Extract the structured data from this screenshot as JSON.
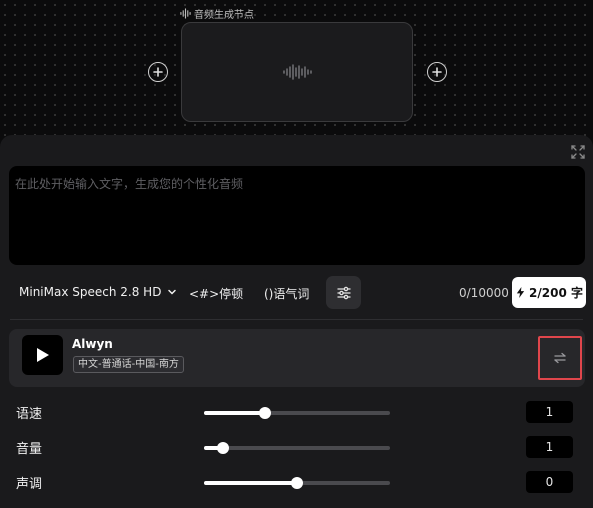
{
  "node": {
    "label": "音频生成节点"
  },
  "editor": {
    "placeholder": "在此处开始输入文字，生成您的个性化音频"
  },
  "toolbar": {
    "model": "MiniMax Speech 2.8 HD",
    "pause_tag": "<#>停顿",
    "tone_tag": "()语气词",
    "char_count": "0/10000",
    "quota": "2/200 字"
  },
  "voice": {
    "name": "Alwyn",
    "tag": "中文-普通话-中国-南方"
  },
  "params": [
    {
      "label": "语速",
      "value": "1",
      "level": 0.33
    },
    {
      "label": "音量",
      "value": "1",
      "level": 0.1
    },
    {
      "label": "声调",
      "value": "0",
      "level": 0.5
    }
  ],
  "colors": {
    "highlight": "#e0464c",
    "panel": "#1a1a1c",
    "accent": "#ffffff"
  }
}
